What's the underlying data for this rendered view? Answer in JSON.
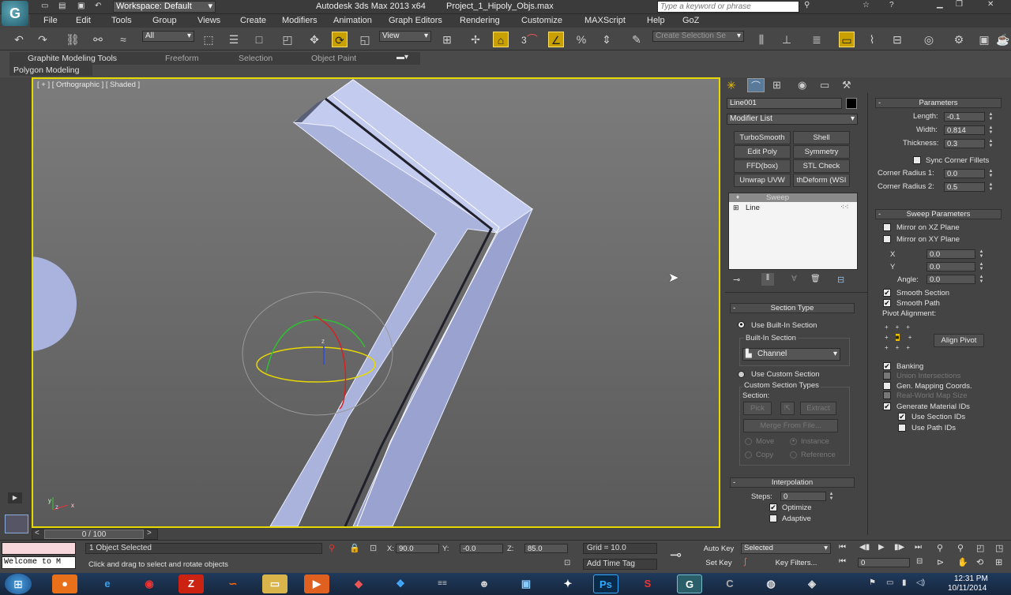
{
  "title_bar": {
    "workspace": "Workspace: Default",
    "app_title": "Autodesk 3ds Max  2013 x64",
    "file_name": "Project_1_Hipoly_Objs.max",
    "search_placeholder": "Type a keyword or phrase"
  },
  "menu": [
    "File",
    "Edit",
    "Tools",
    "Group",
    "Views",
    "Create",
    "Modifiers",
    "Animation",
    "Graph Editors",
    "Rendering",
    "Customize",
    "MAXScript",
    "Help",
    "GoZ"
  ],
  "toolbar": {
    "selection_filter": "All",
    "ref_coord": "View",
    "snap_label": "3",
    "named_selection_placeholder": "Create Selection Se"
  },
  "ribbon": {
    "tabs": [
      "Graphite Modeling Tools",
      "Freeform",
      "Selection",
      "Object Paint"
    ],
    "sub_label": "Polygon Modeling"
  },
  "viewport": {
    "label": "[ + ] [ Orthographic ] [ Shaded ]",
    "gizmo_axis": "z",
    "axis_labels": [
      "y",
      "z",
      "x"
    ]
  },
  "command_panel": {
    "object_name": "Line001",
    "modifier_list": "Modifier List",
    "modifier_buttons": [
      "TurboSmooth",
      "Shell",
      "Edit Poly",
      "Symmetry",
      "FFD(box)",
      "STL Check",
      "Unwrap UVW",
      "thDeform (WSI"
    ],
    "stack": [
      "Sweep",
      "Line"
    ],
    "section_type": {
      "header": "Section Type",
      "use_builtin": "Use Built-In Section",
      "builtin_label": "Built-In Section",
      "builtin_value": "Channel",
      "use_custom": "Use Custom Section",
      "custom_types": "Custom Section Types",
      "section_label": "Section:",
      "pick": "Pick",
      "extract": "Extract",
      "merge": "Merge From File...",
      "move": "Move",
      "instance": "Instance",
      "copy": "Copy",
      "reference": "Reference"
    },
    "interpolation": {
      "header": "Interpolation",
      "steps_label": "Steps:",
      "steps_value": "0",
      "optimize": "Optimize",
      "adaptive": "Adaptive"
    }
  },
  "parameters": {
    "header": "Parameters",
    "length_label": "Length:",
    "length": "-0.1",
    "width_label": "Width:",
    "width": "0.814",
    "thickness_label": "Thickness:",
    "thickness": "0.3",
    "sync_corner": "Sync Corner Fillets",
    "corner_radius_1_label": "Corner Radius 1:",
    "corner_radius_1": "0.0",
    "corner_radius_2_label": "Corner Radius 2:",
    "corner_radius_2": "0.5"
  },
  "sweep_parameters": {
    "header": "Sweep Parameters",
    "mirror_xz": "Mirror on XZ Plane",
    "mirror_xy": "Mirror on XY Plane",
    "x_label": "X",
    "x": "0.0",
    "y_label": "Y",
    "y": "0.0",
    "angle_label": "Angle:",
    "angle": "0.0",
    "smooth_section": "Smooth Section",
    "smooth_path": "Smooth Path",
    "pivot_alignment": "Pivot Alignment:",
    "align_pivot": "Align Pivot",
    "banking": "Banking",
    "union_intersections": "Union Intersections",
    "gen_mapping": "Gen. Mapping Coords.",
    "real_world_map": "Real-World Map Size",
    "gen_material_ids": "Generate Material IDs",
    "use_section_ids": "Use Section IDs",
    "use_path_ids": "Use Path IDs"
  },
  "timeline": {
    "frame": "0 / 100"
  },
  "status": {
    "maxscript": "Welcome to M",
    "selected": "1 Object Selected",
    "prompt": "Click and drag to select and rotate objects",
    "x_label": "X:",
    "x": "90.0",
    "y_label": "Y:",
    "y": "-0.0",
    "z_label": "Z:",
    "z": "85.0",
    "grid": "Grid = 10.0",
    "add_time_tag": "Add Time Tag",
    "auto_key": "Auto Key",
    "set_key": "Set Key",
    "key_mode": "Selected",
    "key_filters": "Key Filters...",
    "current_frame": "0"
  },
  "taskbar": {
    "time": "12:31 PM",
    "date": "10/11/2014"
  },
  "colors": {
    "viewport_border": "#e6d800",
    "mesh": "#b7c0e4",
    "accent": "#f0c000"
  }
}
